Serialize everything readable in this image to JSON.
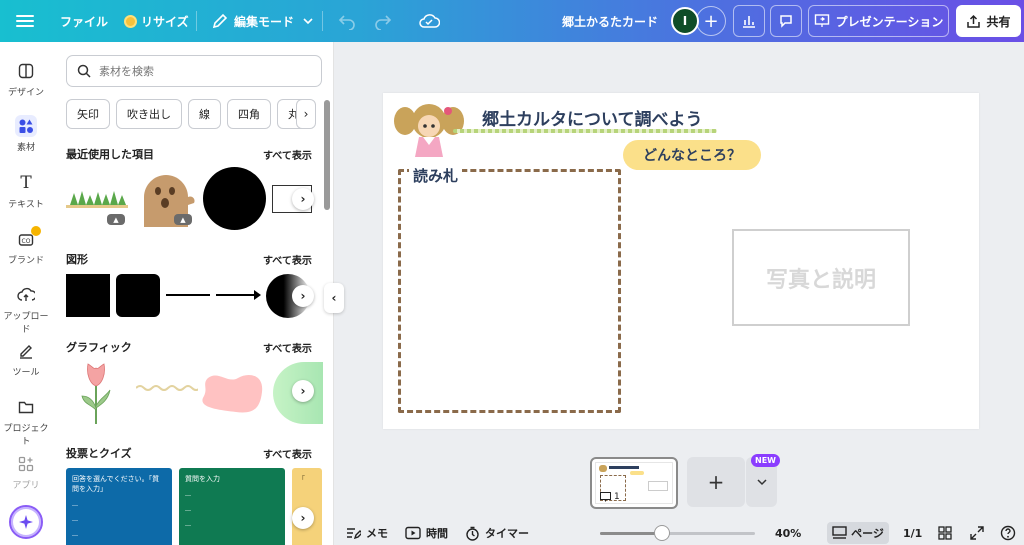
{
  "topbar": {
    "file": "ファイル",
    "resize": "リサイズ",
    "edit_mode": "編集モード",
    "doc_title": "郷土かるたカード",
    "avatar_initial": "I",
    "present": "プレゼンテーション",
    "share": "共有"
  },
  "rail": [
    {
      "label": "デザイン",
      "icon": "layout-icon"
    },
    {
      "label": "素材",
      "icon": "elements-icon"
    },
    {
      "label": "テキスト",
      "icon": "text-icon"
    },
    {
      "label": "ブランド",
      "icon": "brand-icon"
    },
    {
      "label": "アップロード",
      "icon": "upload-icon"
    },
    {
      "label": "ツール",
      "icon": "draw-icon"
    },
    {
      "label": "プロジェクト",
      "icon": "folder-icon"
    },
    {
      "label": "アプリ",
      "icon": "apps-icon"
    }
  ],
  "panel": {
    "search_placeholder": "素材を検索",
    "chips": [
      "矢印",
      "吹き出し",
      "線",
      "四角",
      "丸"
    ],
    "see_all": "すべて表示",
    "sections": {
      "recent": "最近使用した項目",
      "shapes": "図形",
      "graphics": "グラフィック",
      "polls": "投票とクイズ"
    },
    "polls": [
      {
        "title": "回答を選んでください。「質問を入力」",
        "color": "#0d6aa8"
      },
      {
        "title": "質問を入力",
        "color": "#0f7a52"
      },
      {
        "title": "「",
        "color": "#f5d27a"
      }
    ]
  },
  "slide": {
    "title": "郷土カルタについて調べよう",
    "pill": "どんなところ？",
    "frame_label": "読み札",
    "photo_label": "写真と説明"
  },
  "pages": {
    "thumb_number": "1",
    "new_badge": "NEW"
  },
  "bottombar": {
    "notes": "メモ",
    "duration": "時間",
    "timer": "タイマー",
    "zoom": "40%",
    "zoom_value": 0.4,
    "page_view": "ページ",
    "page_count": "1/1"
  },
  "colors": {
    "accent": "#8b3dff",
    "title_text": "#2d3f5e",
    "pill_bg": "#fbe08a"
  }
}
